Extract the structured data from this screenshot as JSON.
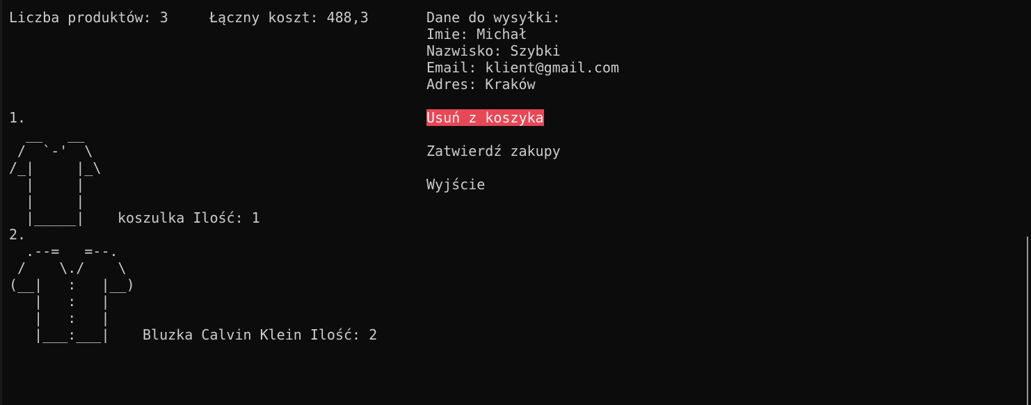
{
  "summary": {
    "count_text": "Liczba produktów: 3",
    "total_text": "Łączny koszt: 488,3"
  },
  "shipping": {
    "header": "Dane do wysyłki:",
    "first_name": "Imie: Michał",
    "last_name": "Nazwisko: Szybki",
    "email": "Email: klient@gmail.com",
    "address": "Adres: Kraków"
  },
  "menu": {
    "items": [
      {
        "label": "Usuń z koszyka",
        "selected": true
      },
      {
        "label": "Zatwierdź zakupy",
        "selected": false
      },
      {
        "label": "Wyjście",
        "selected": false
      }
    ]
  },
  "products": [
    {
      "number": "1.",
      "art": "  __   __\n /  `-'  \\\n/_|     |_\\\n  |     |\n  |     |\n  |_____|",
      "name_qty": "koszulka Ilość: 1"
    },
    {
      "number": "2.",
      "art": "  .--=   =--.\n /    \\./    \\\n(__|   :   |__)\n   |   :   |\n   |   :   |\n   |___:___|",
      "name_qty": "Bluzka Calvin Klein Ilość: 2"
    }
  ],
  "colors": {
    "background": "#0c0c0c",
    "text": "#cccccc",
    "selected_bg": "#e74856",
    "selected_text": "#f2f2f2"
  }
}
